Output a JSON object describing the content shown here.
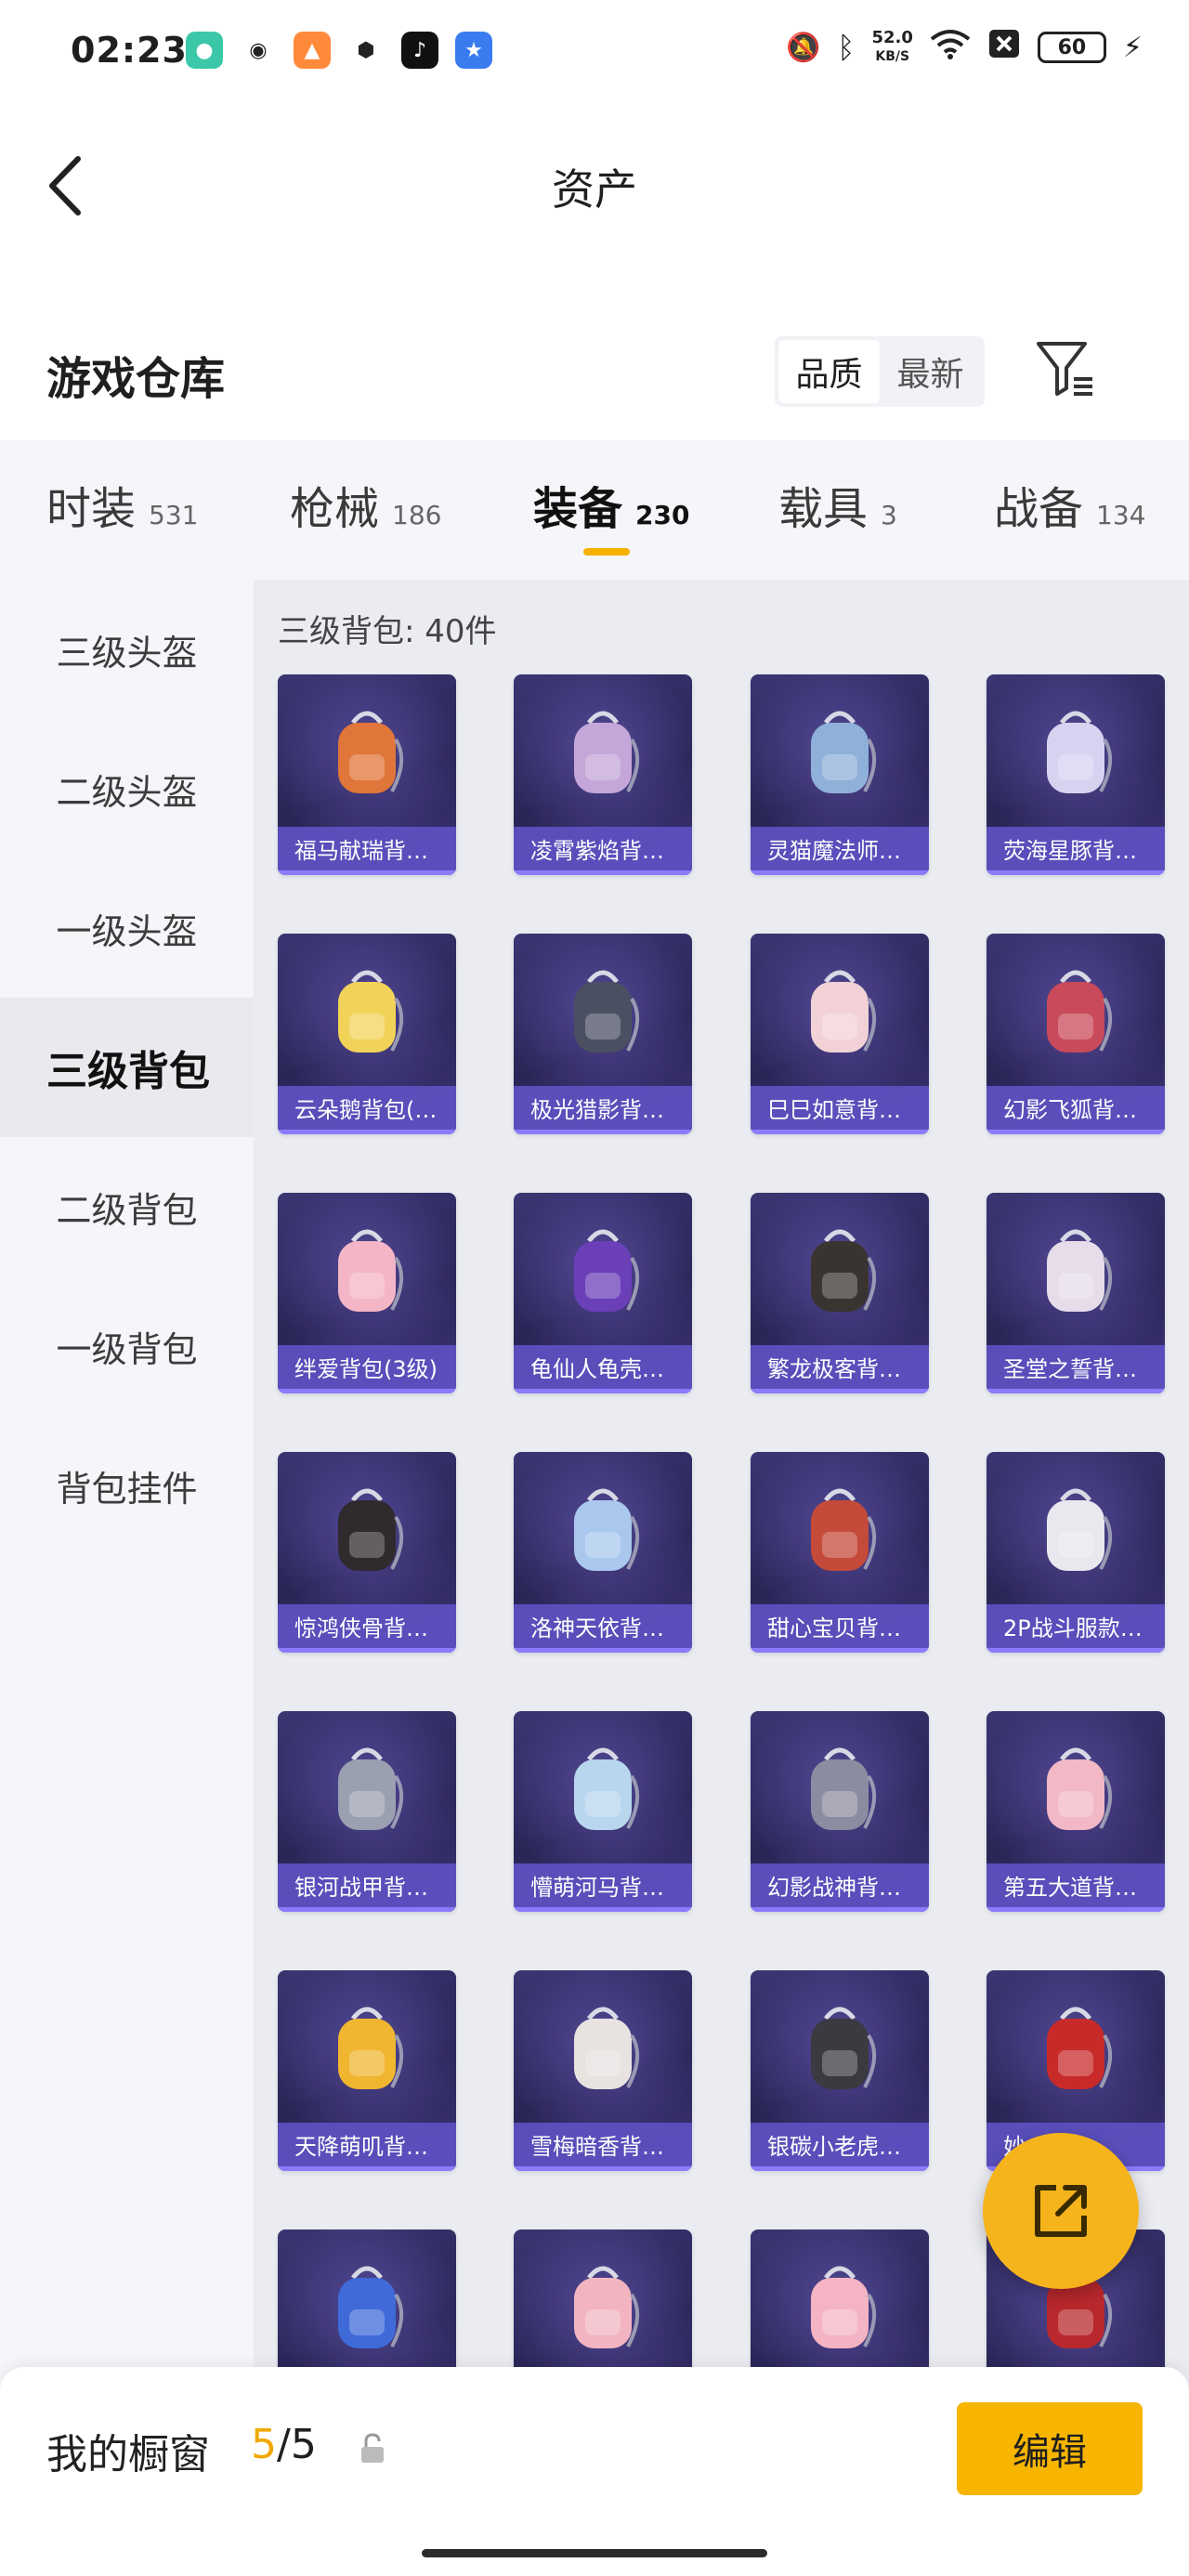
{
  "status_bar": {
    "time": "02:23",
    "net_speed_value": "52.0",
    "net_speed_unit": "KB/S",
    "battery": "60",
    "app_icons": [
      "chat-bubble-icon",
      "wechat-icon",
      "game-icon",
      "shield-icon",
      "tiktok-icon",
      "qq-game-icon"
    ]
  },
  "header": {
    "title": "资产"
  },
  "section": {
    "title": "游戏仓库",
    "sort_options": [
      "品质",
      "最新"
    ],
    "sort_selected": "品质"
  },
  "category_tabs": [
    {
      "label": "时装",
      "count": "531"
    },
    {
      "label": "枪械",
      "count": "186"
    },
    {
      "label": "装备",
      "count": "230"
    },
    {
      "label": "载具",
      "count": "3"
    },
    {
      "label": "战备",
      "count": "134"
    }
  ],
  "category_selected": "装备",
  "side_menu": [
    {
      "label": "三级头盔"
    },
    {
      "label": "二级头盔"
    },
    {
      "label": "一级头盔"
    },
    {
      "label": "三级背包"
    },
    {
      "label": "二级背包"
    },
    {
      "label": "一级背包"
    },
    {
      "label": "背包挂件"
    }
  ],
  "side_selected": "三级背包",
  "content": {
    "subheading": "三级背包: 40件",
    "items": [
      {
        "name": "福马献瑞背…",
        "color": "#e0763a"
      },
      {
        "name": "凌霄紫焰背…",
        "color": "#c4a6d8"
      },
      {
        "name": "灵猫魔法师…",
        "color": "#8fb0d8"
      },
      {
        "name": "荧海星豚背…",
        "color": "#d8d2f0"
      },
      {
        "name": "云朵鹅背包(…",
        "color": "#f2d35a"
      },
      {
        "name": "极光猎影背…",
        "color": "#4b4f62"
      },
      {
        "name": "巳巳如意背…",
        "color": "#f2d2d6"
      },
      {
        "name": "幻影飞狐背…",
        "color": "#c94a5a"
      },
      {
        "name": "绊爱背包(3级)",
        "color": "#f4b6c6"
      },
      {
        "name": "龟仙人龟壳…",
        "color": "#6a3fb8"
      },
      {
        "name": "繁龙极客背…",
        "color": "#3a3430"
      },
      {
        "name": "圣堂之誓背…",
        "color": "#e6dcea"
      },
      {
        "name": "惊鸿侠骨背…",
        "color": "#2f2a2e"
      },
      {
        "name": "洛神天依背…",
        "color": "#aac8ee"
      },
      {
        "name": "甜心宝贝背…",
        "color": "#c44a3a"
      },
      {
        "name": "2P战斗服款…",
        "color": "#e8e8ee"
      },
      {
        "name": "银河战甲背…",
        "color": "#9aa0b0"
      },
      {
        "name": "懵萌河马背…",
        "color": "#b8d6ee"
      },
      {
        "name": "幻影战神背…",
        "color": "#8c8ca0"
      },
      {
        "name": "第五大道背…",
        "color": "#f2b8c6"
      },
      {
        "name": "天降萌叽背…",
        "color": "#f0b630"
      },
      {
        "name": "雪梅暗香背…",
        "color": "#e8e2e0"
      },
      {
        "name": "银碳小老虎…",
        "color": "#3a3a40"
      },
      {
        "name": "妙…背…",
        "color": "#c82a2a"
      },
      {
        "name": "",
        "color": "#3f6ad8"
      },
      {
        "name": "",
        "color": "#f2b4c0"
      },
      {
        "name": "",
        "color": "#f4b4c4"
      },
      {
        "name": "",
        "color": "#b8282c"
      }
    ]
  },
  "bottom_bar": {
    "label": "我的橱窗",
    "current": "5",
    "separator": "/",
    "total": "5",
    "edit_label": "编辑"
  }
}
